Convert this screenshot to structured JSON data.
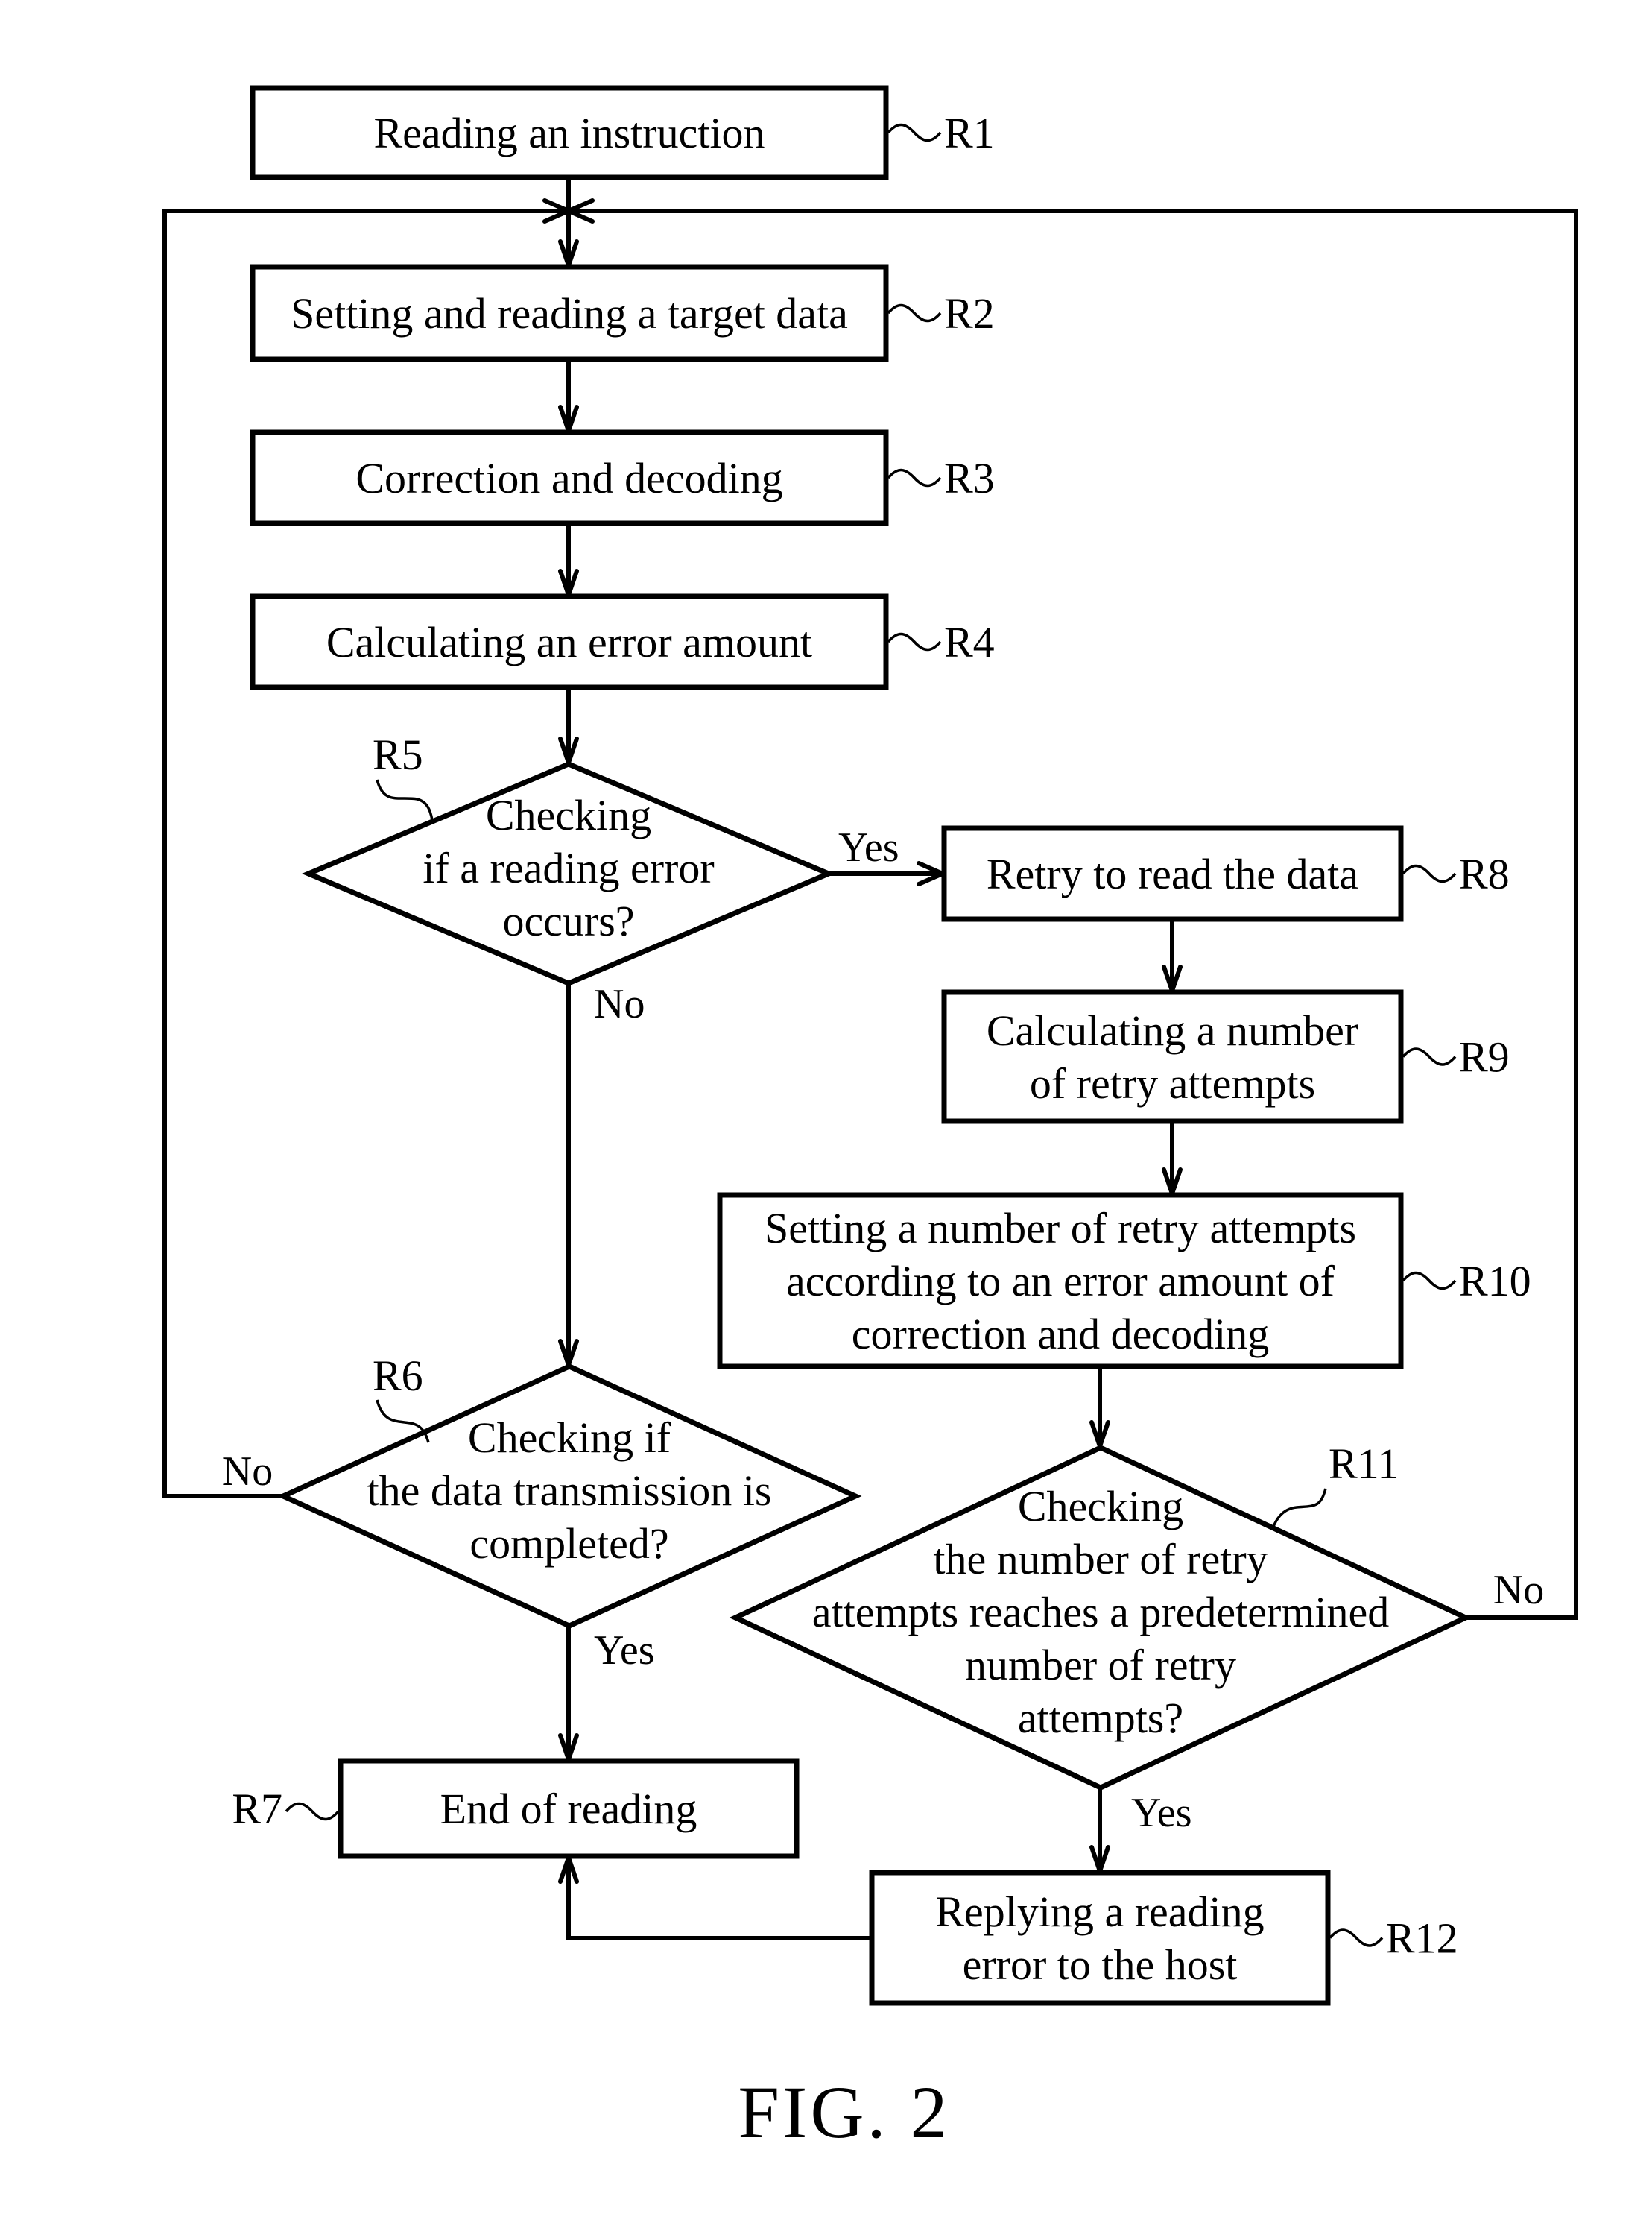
{
  "figure": {
    "caption": "FIG. 2",
    "colors": {
      "stroke": "#000000",
      "background": "#ffffff"
    }
  },
  "steps": {
    "R1": {
      "ref": "R1",
      "shape": "process",
      "lines": [
        "Reading an instruction"
      ]
    },
    "R2": {
      "ref": "R2",
      "shape": "process",
      "lines": [
        "Setting and reading a target data"
      ]
    },
    "R3": {
      "ref": "R3",
      "shape": "process",
      "lines": [
        "Correction and decoding"
      ]
    },
    "R4": {
      "ref": "R4",
      "shape": "process",
      "lines": [
        "Calculating an error amount"
      ]
    },
    "R5": {
      "ref": "R5",
      "shape": "decision",
      "lines": [
        "Checking",
        "if a reading error",
        "occurs?"
      ]
    },
    "R6": {
      "ref": "R6",
      "shape": "decision",
      "lines": [
        "Checking if",
        "the data transmission is",
        "completed?"
      ]
    },
    "R7": {
      "ref": "R7",
      "shape": "process",
      "lines": [
        "End of reading"
      ]
    },
    "R8": {
      "ref": "R8",
      "shape": "process",
      "lines": [
        "Retry to read the data"
      ]
    },
    "R9": {
      "ref": "R9",
      "shape": "process",
      "lines": [
        "Calculating a number",
        "of retry attempts"
      ]
    },
    "R10": {
      "ref": "R10",
      "shape": "process",
      "lines": [
        "Setting a number of retry attempts",
        "according to an error amount of",
        "correction and decoding"
      ]
    },
    "R11": {
      "ref": "R11",
      "shape": "decision",
      "lines": [
        "Checking",
        "the number of retry",
        "attempts reaches a predetermined",
        "number of retry",
        "attempts?"
      ]
    },
    "R12": {
      "ref": "R12",
      "shape": "process",
      "lines": [
        "Replying a reading",
        "error to the host"
      ]
    }
  },
  "edges": [
    {
      "from": "R1",
      "to": "R2",
      "label": ""
    },
    {
      "from": "R2",
      "to": "R3",
      "label": ""
    },
    {
      "from": "R3",
      "to": "R4",
      "label": ""
    },
    {
      "from": "R4",
      "to": "R5",
      "label": ""
    },
    {
      "from": "R5",
      "to": "R8",
      "label": "Yes"
    },
    {
      "from": "R5",
      "to": "R6",
      "label": "No"
    },
    {
      "from": "R6",
      "to": "R2",
      "label": "No"
    },
    {
      "from": "R6",
      "to": "R7",
      "label": "Yes"
    },
    {
      "from": "R8",
      "to": "R9",
      "label": ""
    },
    {
      "from": "R9",
      "to": "R10",
      "label": ""
    },
    {
      "from": "R10",
      "to": "R11",
      "label": ""
    },
    {
      "from": "R11",
      "to": "R2",
      "label": "No"
    },
    {
      "from": "R11",
      "to": "R12",
      "label": "Yes"
    },
    {
      "from": "R12",
      "to": "R7",
      "label": ""
    }
  ]
}
